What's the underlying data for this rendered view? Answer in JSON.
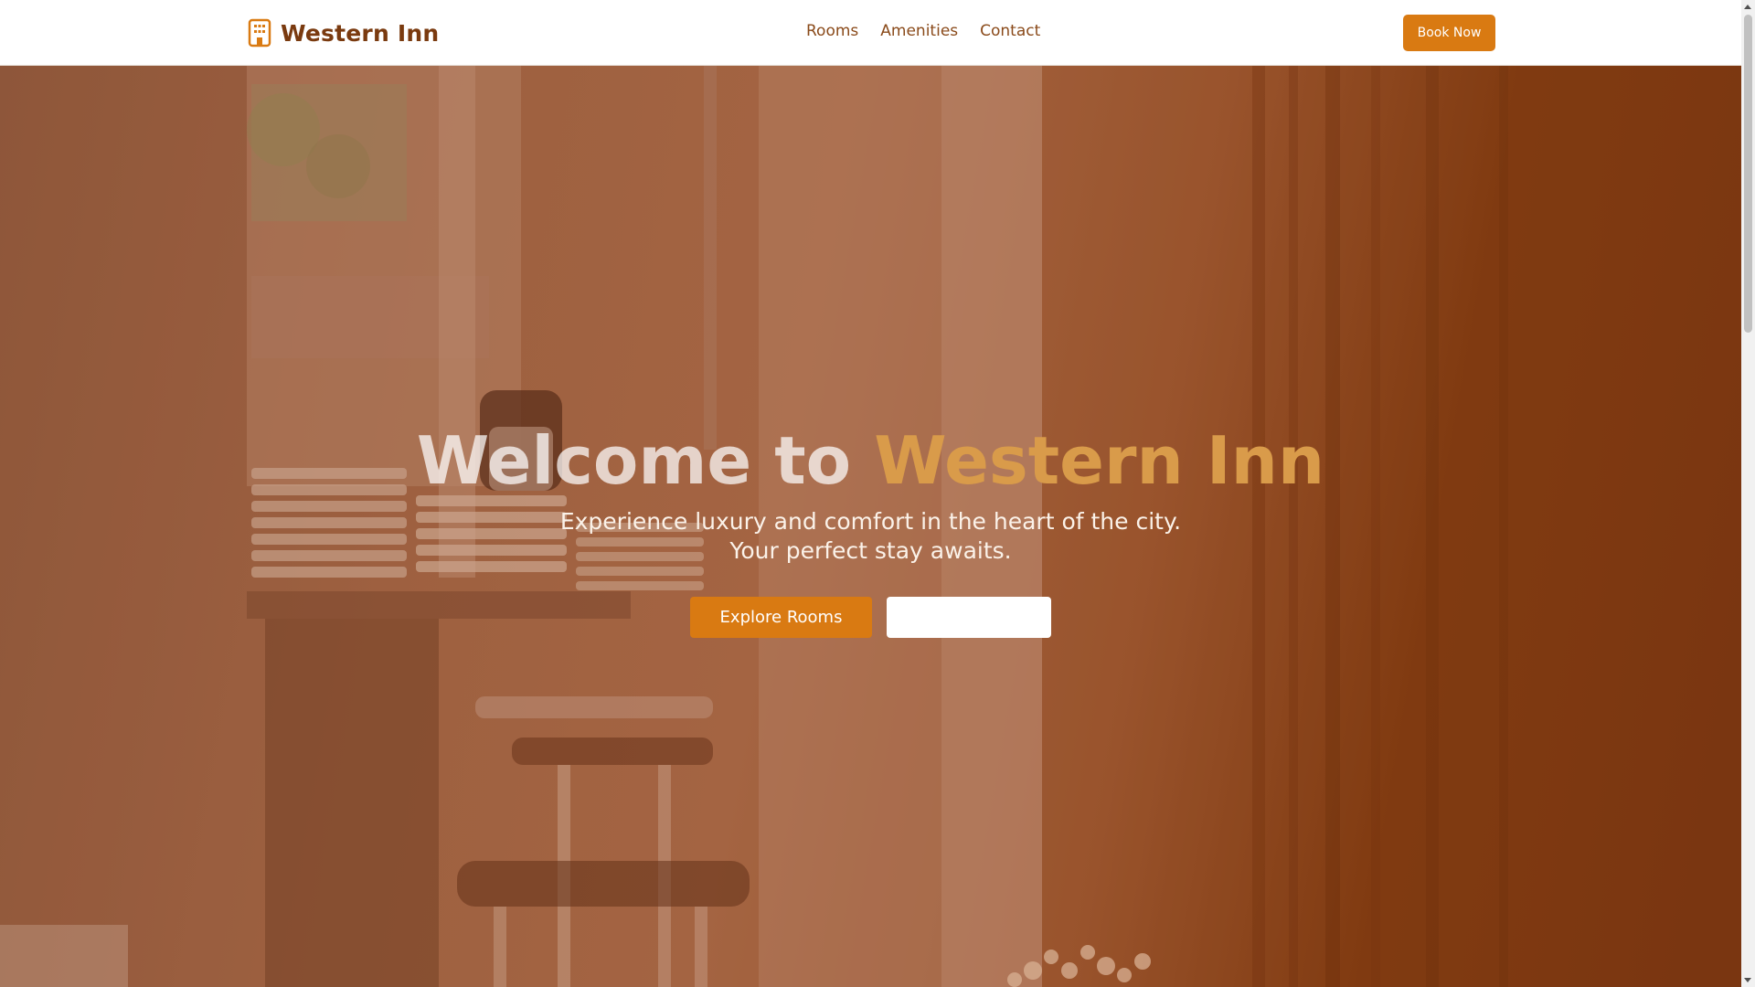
{
  "brand": {
    "name": "Western Inn",
    "icon": "building-icon",
    "color": "#7a3a0f"
  },
  "nav": {
    "links": [
      "Rooms",
      "Amenities",
      "Contact"
    ],
    "cta_label": "Book Now"
  },
  "hero": {
    "title_lead": "Welcome to",
    "title_accent": "Western Inn",
    "subtitle": "Experience luxury and comfort in the heart of the city. Your perfect stay awaits.",
    "primary_button": "Explore Rooms",
    "secondary_button": ""
  },
  "colors": {
    "accent": "#d97a12",
    "title_accent": "#d99b4a"
  }
}
